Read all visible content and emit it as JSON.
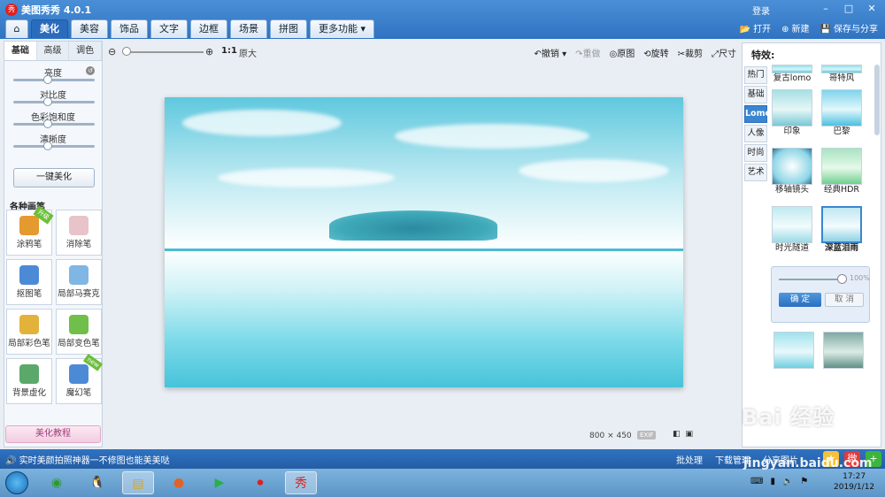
{
  "app": {
    "title": "美图秀秀 4.0.1",
    "logo_text": "秀",
    "login": "登录",
    "minimize": "–",
    "restore": "□",
    "close": "✕"
  },
  "tabs": [
    {
      "label": "⌂",
      "icon": "home-icon"
    },
    {
      "label": "美化"
    },
    {
      "label": "美容"
    },
    {
      "label": "饰品"
    },
    {
      "label": "文字"
    },
    {
      "label": "边框"
    },
    {
      "label": "场景"
    },
    {
      "label": "拼图"
    },
    {
      "label": "更多功能 ▾"
    }
  ],
  "top_actions": {
    "open": "打开",
    "new": "新建",
    "save_share": "保存与分享"
  },
  "left": {
    "subtabs": [
      "基础",
      "高级",
      "调色"
    ],
    "sliders": [
      {
        "label": "亮度",
        "value": 0.5
      },
      {
        "label": "对比度",
        "value": 0.5
      },
      {
        "label": "色彩饱和度",
        "value": 0.5
      },
      {
        "label": "清晰度",
        "value": 0.5
      }
    ],
    "onekey": "一键美化",
    "brush_title": "各种画笔",
    "brushes": [
      {
        "label": "涂鸦笔",
        "badge": "升级",
        "color": "#e59a2f"
      },
      {
        "label": "消除笔",
        "badge": "",
        "color": "#e8c3c9"
      },
      {
        "label": "抠图笔",
        "badge": "",
        "color": "#4d8ad6"
      },
      {
        "label": "局部马赛克",
        "badge": "",
        "color": "#7fb6e3"
      },
      {
        "label": "局部彩色笔",
        "badge": "",
        "color": "#e3b23a"
      },
      {
        "label": "局部变色笔",
        "badge": "",
        "color": "#6fbf4a"
      },
      {
        "label": "背景虚化",
        "badge": "",
        "color": "#5aa96b"
      },
      {
        "label": "魔幻笔",
        "badge": "new",
        "color": "#4d8ad6"
      }
    ],
    "tutorial": "美化教程"
  },
  "toolbar": {
    "zoom_ratio": "1:1",
    "zoom_original": "原大",
    "undo": "撤销",
    "redo": "重做",
    "original": "原图",
    "rotate": "旋转",
    "crop": "裁剪",
    "size": "尺寸"
  },
  "image": {
    "width": "800",
    "x": "×",
    "height": "450",
    "exif": "EXIF"
  },
  "right": {
    "title": "特效:",
    "categories": [
      "热门",
      "基础",
      "Lomo",
      "人像",
      "时尚",
      "艺术"
    ],
    "active_category": "Lomo",
    "effects": [
      {
        "name": "复古lomo"
      },
      {
        "name": "哥特风"
      },
      {
        "name": "印象"
      },
      {
        "name": "巴黎"
      },
      {
        "name": "移轴镜头"
      },
      {
        "name": "经典HDR"
      },
      {
        "name": "时光隧道"
      },
      {
        "name": "深蓝泪雨"
      }
    ],
    "opacity_percent": "100%",
    "ok": "确 定",
    "cancel": "取 消"
  },
  "status": {
    "message": "实时美颜拍照神器一不修图也能美美哒",
    "batch": "批处理",
    "download": "下载管理",
    "share": "分享图片"
  },
  "taskbar": {
    "time": "17:27",
    "date": "2019/1/12"
  },
  "watermark": {
    "line1": "Bai 经验",
    "line2": "jingyan.baidu.com"
  }
}
